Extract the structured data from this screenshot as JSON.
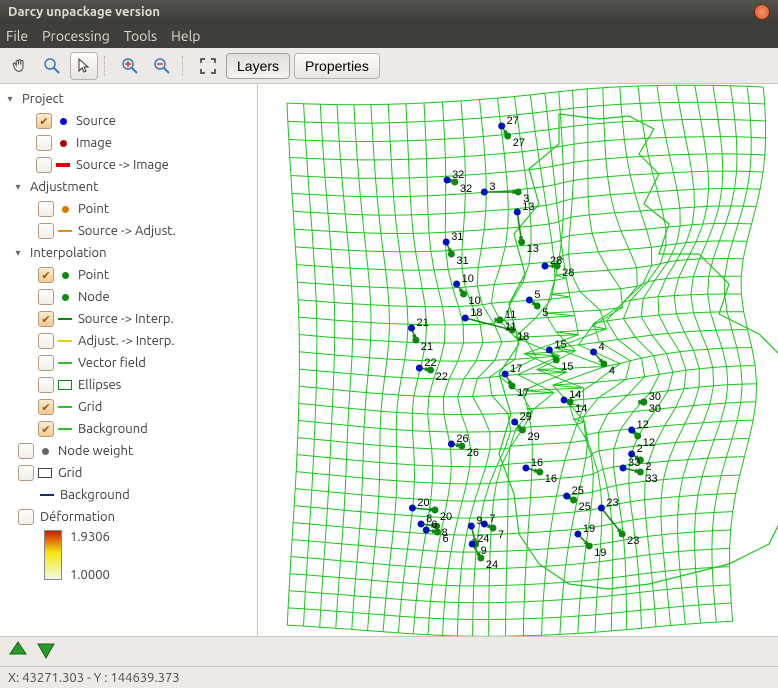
{
  "window": {
    "title": "Darcy unpackage version"
  },
  "menu": {
    "file": "File",
    "processing": "Processing",
    "tools": "Tools",
    "help": "Help"
  },
  "tabs": {
    "layers": "Layers",
    "properties": "Properties"
  },
  "tree": {
    "project": "Project",
    "source": "Source",
    "image": "Image",
    "source_image": "Source -> Image",
    "adjustment": "Adjustment",
    "adj_point": "Point",
    "source_adjust": "Source -> Adjust.",
    "interpolation": "Interpolation",
    "int_point": "Point",
    "node": "Node",
    "source_interp": "Source -> Interp.",
    "adjust_interp": "Adjust. -> Interp.",
    "vector_field": "Vector field",
    "ellipses": "Ellipses",
    "grid": "Grid",
    "background": "Background",
    "node_weight": "Node weight",
    "grid2": "Grid",
    "background2": "Background",
    "deformation": "Déformation",
    "legend_max": "1.9306",
    "legend_min": "1.0000"
  },
  "status": {
    "coords": "X: 43271.303 - Y : 144639.373"
  },
  "chart_data": {
    "type": "scatter",
    "note": "Deformation grid with source (blue) and interpolated (green) points, numbered",
    "points": [
      {
        "id": 27,
        "bx": 380,
        "by": 42,
        "gx": 387,
        "gy": 52
      },
      {
        "id": 32,
        "bx": 317,
        "by": 96,
        "gx": 326,
        "gy": 98
      },
      {
        "id": 3,
        "bx": 360,
        "by": 108,
        "gx": 399,
        "gy": 108
      },
      {
        "id": 13,
        "bx": 398,
        "by": 128,
        "gx": 403,
        "gy": 158
      },
      {
        "id": 31,
        "bx": 316,
        "by": 158,
        "gx": 322,
        "gy": 170
      },
      {
        "id": 28,
        "bx": 430,
        "by": 182,
        "gx": 444,
        "gy": 182
      },
      {
        "id": 10,
        "bx": 328,
        "by": 200,
        "gx": 336,
        "gy": 210
      },
      {
        "id": 5,
        "bx": 412,
        "by": 216,
        "gx": 421,
        "gy": 222
      },
      {
        "id": 21,
        "bx": 276,
        "by": 244,
        "gx": 281,
        "gy": 256
      },
      {
        "id": 18,
        "bx": 338,
        "by": 234,
        "gx": 392,
        "gy": 246
      },
      {
        "id": 11,
        "bx": 378,
        "by": 236,
        "gx": 378,
        "gy": 236
      },
      {
        "id": 15,
        "bx": 435,
        "by": 266,
        "gx": 443,
        "gy": 276
      },
      {
        "id": 4,
        "bx": 486,
        "by": 268,
        "gx": 498,
        "gy": 280
      },
      {
        "id": 22,
        "bx": 285,
        "by": 284,
        "gx": 298,
        "gy": 286
      },
      {
        "id": 17,
        "bx": 384,
        "by": 290,
        "gx": 392,
        "gy": 302
      },
      {
        "id": 14,
        "bx": 452,
        "by": 316,
        "gx": 459,
        "gy": 318
      },
      {
        "id": 30,
        "bx": 544,
        "by": 318,
        "gx": 544,
        "gy": 318
      },
      {
        "id": 29,
        "bx": 395,
        "by": 338,
        "gx": 404,
        "gy": 346
      },
      {
        "id": 12,
        "bx": 530,
        "by": 346,
        "gx": 537,
        "gy": 352
      },
      {
        "id": 26,
        "bx": 322,
        "by": 360,
        "gx": 334,
        "gy": 362
      },
      {
        "id": 2,
        "bx": 530,
        "by": 370,
        "gx": 540,
        "gy": 376
      },
      {
        "id": 33,
        "bx": 520,
        "by": 384,
        "gx": 540,
        "gy": 388
      },
      {
        "id": 16,
        "bx": 408,
        "by": 384,
        "gx": 424,
        "gy": 388
      },
      {
        "id": 25,
        "bx": 455,
        "by": 412,
        "gx": 463,
        "gy": 416
      },
      {
        "id": 20,
        "bx": 277,
        "by": 424,
        "gx": 303,
        "gy": 426
      },
      {
        "id": 23,
        "bx": 495,
        "by": 424,
        "gx": 519,
        "gy": 450
      },
      {
        "id": 8,
        "bx": 287,
        "by": 440,
        "gx": 305,
        "gy": 442
      },
      {
        "id": 6,
        "bx": 293,
        "by": 446,
        "gx": 306,
        "gy": 448
      },
      {
        "id": 9,
        "bx": 345,
        "by": 442,
        "gx": 350,
        "gy": 460
      },
      {
        "id": 7,
        "bx": 360,
        "by": 440,
        "gx": 370,
        "gy": 444
      },
      {
        "id": 19,
        "bx": 468,
        "by": 450,
        "gx": 481,
        "gy": 462
      },
      {
        "id": 24,
        "bx": 346,
        "by": 460,
        "gx": 356,
        "gy": 474
      }
    ]
  }
}
